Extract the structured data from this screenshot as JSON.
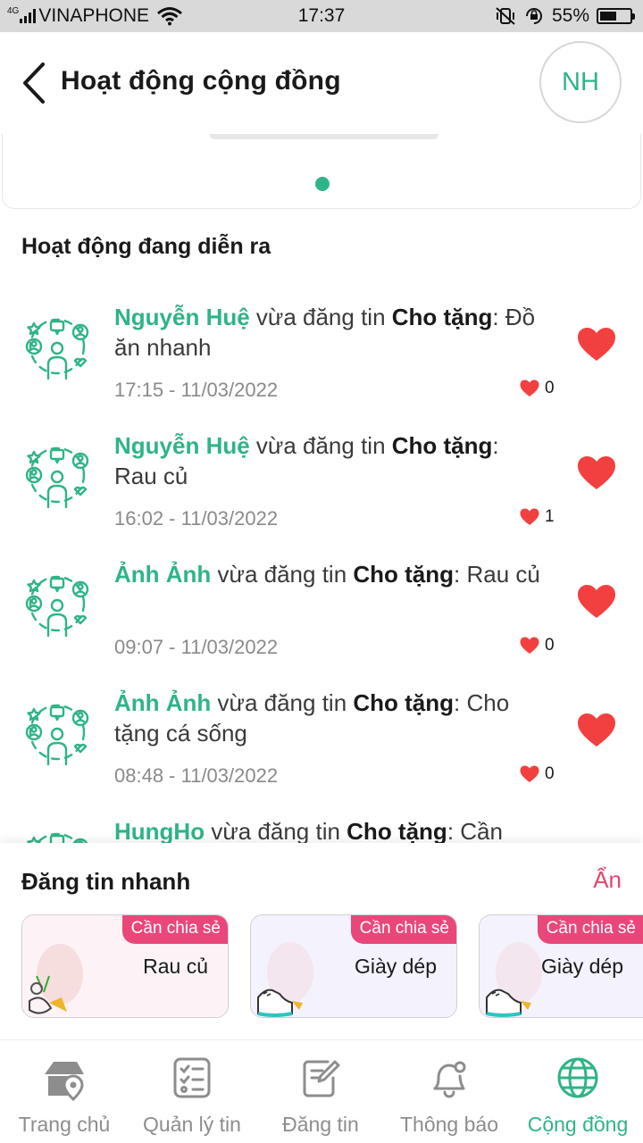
{
  "status_bar": {
    "network": "4G",
    "carrier": "VINAPHONE",
    "time": "17:37",
    "battery": "55%",
    "battery_level": 0.55
  },
  "header": {
    "back_icon": "chevron-left-icon",
    "title": "Hoạt động cộng đồng",
    "avatar_initials": "NH"
  },
  "banner": {
    "page_count": 1,
    "active_index": 0
  },
  "activity": {
    "section_title": "Hoạt động đang diễn ra",
    "connector": "vừa đăng tin",
    "items": [
      {
        "user": "Nguyễn Huệ",
        "category": "Cho tặng",
        "title": "Đồ ăn nhanh",
        "time": "17:15 - 11/03/2022",
        "likes": "0"
      },
      {
        "user": "Nguyễn Huệ",
        "category": "Cho tặng",
        "title": "Rau củ",
        "time": "16:02 - 11/03/2022",
        "likes": "1"
      },
      {
        "user": "Ảnh Ảnh",
        "category": "Cho tặng",
        "title": "Rau củ",
        "time": "09:07 - 11/03/2022",
        "likes": "0"
      },
      {
        "user": "Ảnh Ảnh",
        "category": "Cho tặng",
        "title": "Cho tặng cá sống",
        "time": "08:48 - 11/03/2022",
        "likes": "0"
      },
      {
        "user": "HungHo",
        "category": "Cho tặng",
        "title": "Cần",
        "time": "",
        "likes": ""
      }
    ]
  },
  "quick_post": {
    "title": "Đăng tin nhanh",
    "hide_label": "Ẩn",
    "cards": [
      {
        "tag": "Cần chia sẻ",
        "label": "Rau củ",
        "image": "vegetables-image"
      },
      {
        "tag": "Cần chia sẻ",
        "label": "Giày dép",
        "image": "shoe-image"
      },
      {
        "tag": "Cần chia sẻ",
        "label": "Giày dép",
        "image": "shoe-image"
      }
    ]
  },
  "bottom_nav": [
    {
      "label": "Trang chủ",
      "icon": "home-location-icon",
      "active": false
    },
    {
      "label": "Quản lý tin",
      "icon": "checklist-icon",
      "active": false
    },
    {
      "label": "Đăng tin",
      "icon": "edit-document-icon",
      "active": false
    },
    {
      "label": "Thông báo",
      "icon": "bell-icon",
      "active": false
    },
    {
      "label": "Cộng đồng",
      "icon": "globe-icon",
      "active": true
    }
  ],
  "colors": {
    "accent_green": "#2fb487",
    "accent_pink": "#e9477a",
    "heart_red": "#f24040"
  }
}
